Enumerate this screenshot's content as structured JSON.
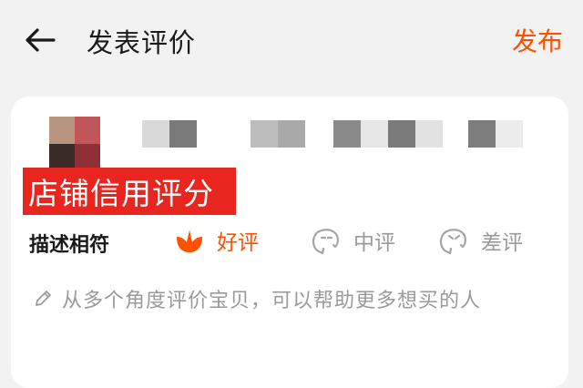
{
  "header": {
    "title": "发表评价",
    "publish_label": "发布"
  },
  "banner": {
    "text": "店铺信用评分"
  },
  "rating": {
    "label": "描述相符",
    "options": [
      {
        "label": "好评",
        "icon": "flower-icon",
        "selected": true
      },
      {
        "label": "中评",
        "icon": "neutral-face-icon",
        "selected": false
      },
      {
        "label": "差评",
        "icon": "bad-face-icon",
        "selected": false
      }
    ]
  },
  "comment": {
    "placeholder": "从多个角度评价宝贝，可以帮助更多想买的人",
    "icon": "pencil-icon"
  },
  "colors": {
    "accent": "#ff5000",
    "banner_bg": "#e8261f",
    "muted": "#9a9a9a"
  }
}
